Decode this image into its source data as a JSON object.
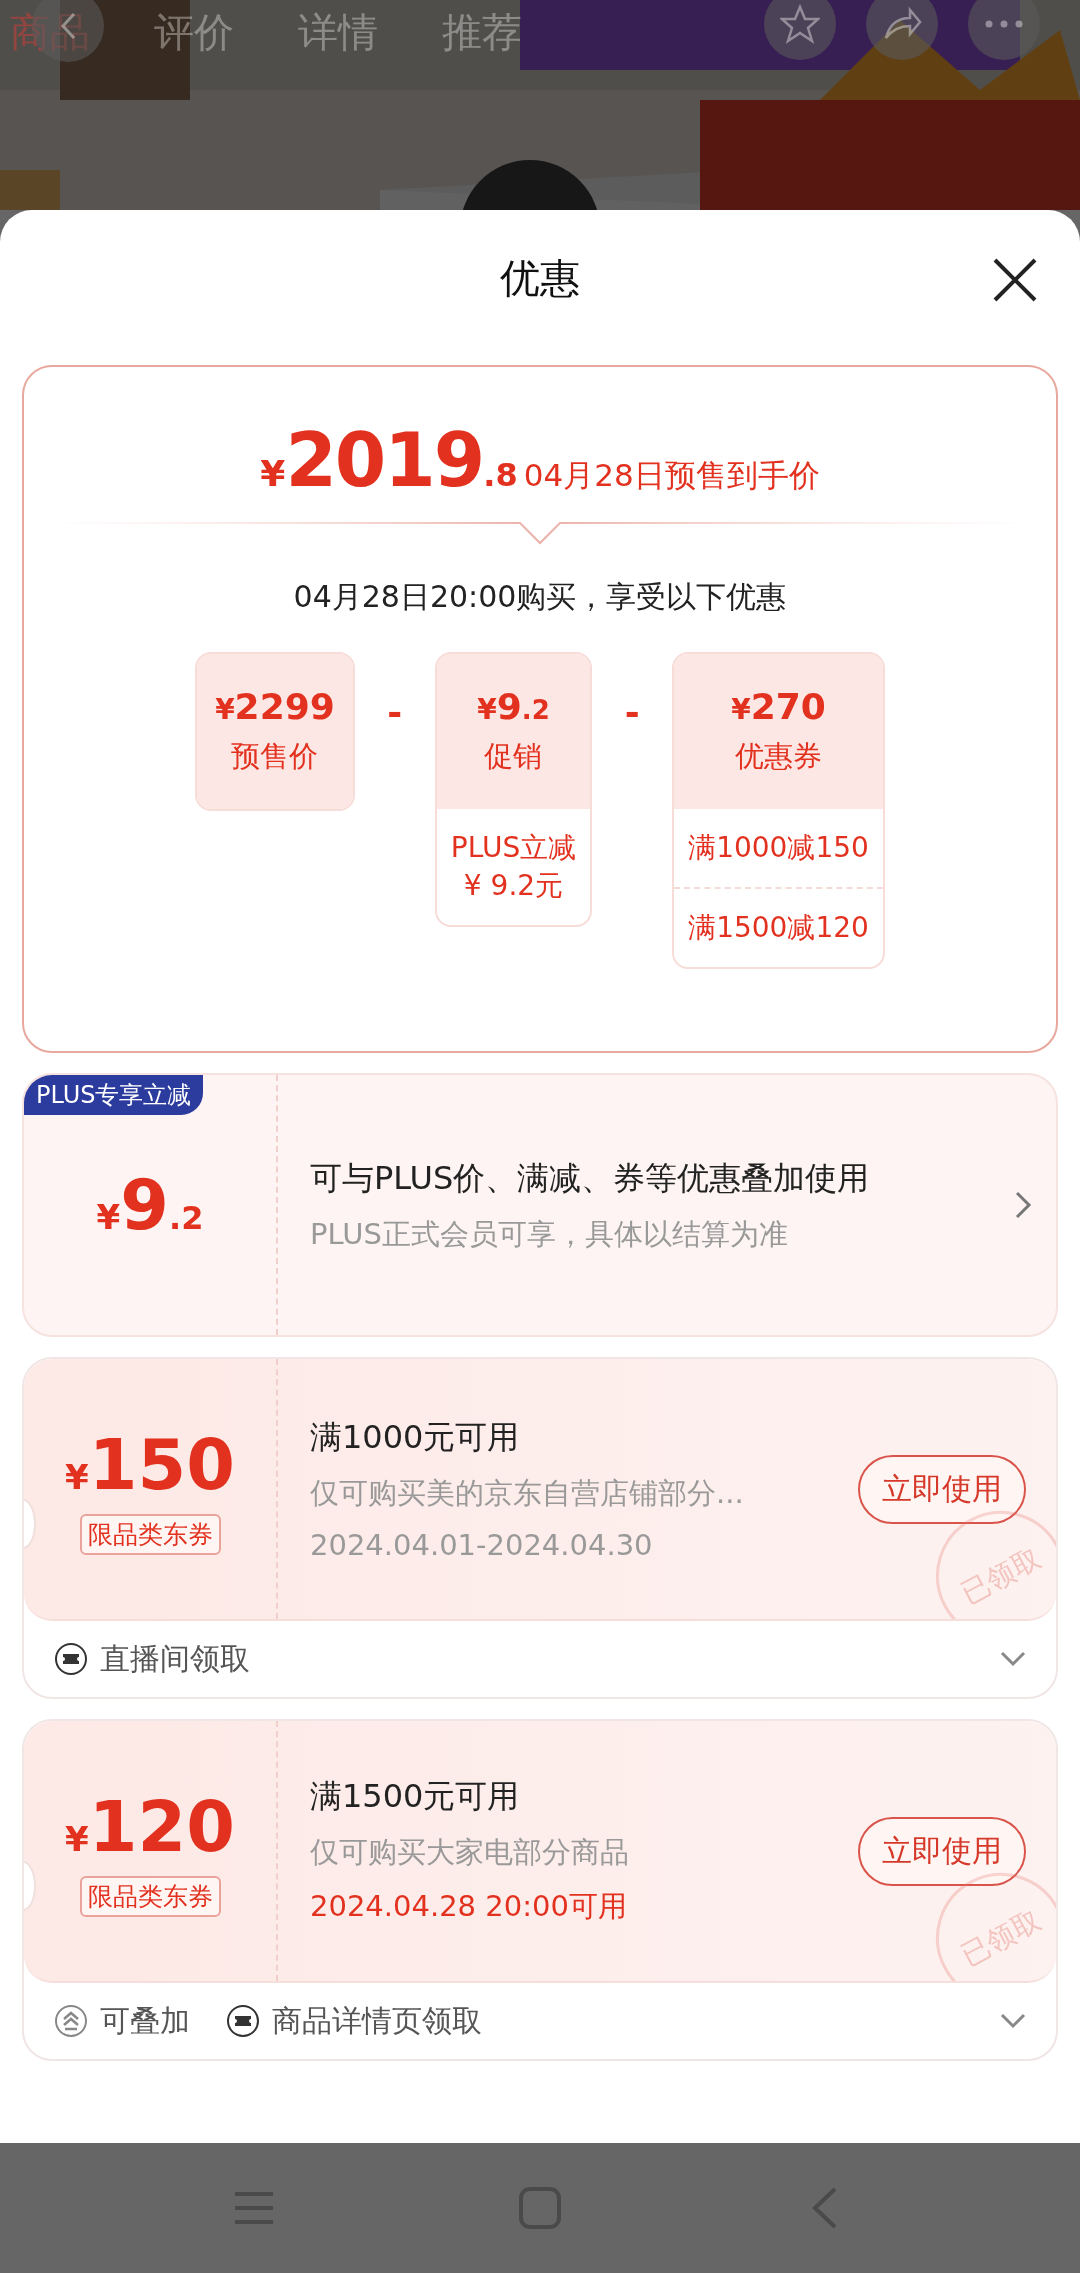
{
  "background_page": {
    "tabs": [
      {
        "label": "商品",
        "selected": true
      },
      {
        "label": "评价",
        "selected": false
      },
      {
        "label": "详情",
        "selected": false
      },
      {
        "label": "推荐",
        "selected": false
      }
    ]
  },
  "sheet": {
    "title": "优惠"
  },
  "summary": {
    "currency": "¥",
    "price_int": "2019",
    "price_dec": ".8",
    "price_label": "04月28日预售到手价",
    "purchase_note": "04月28日20:00购买，享受以下优惠",
    "items": [
      {
        "currency": "¥",
        "value": "2299",
        "label": "预售价"
      },
      {
        "operator": "-",
        "currency": "¥",
        "value": "9",
        "decimal": ".2",
        "label": "促销",
        "details": [
          [
            "PLUS立减",
            "¥ 9.2元"
          ]
        ]
      },
      {
        "operator": "-",
        "currency": "¥",
        "value": "270",
        "label": "优惠券",
        "details": [
          [
            "满1000减150"
          ],
          [
            "满1500减120"
          ]
        ]
      }
    ]
  },
  "offers": [
    {
      "kind": "plus",
      "badge": "PLUS专享立减",
      "currency": "¥",
      "value": "9",
      "decimal": ".2",
      "title": "可与PLUS价、满减、券等优惠叠加使用",
      "subtitle": "PLUS正式会员可享，具体以结算为准"
    },
    {
      "kind": "coupon",
      "currency": "¥",
      "value": "150",
      "tag": "限品类东券",
      "title": "满1000元可用",
      "description": "仅可购买美的京东自营店铺部分...",
      "validity": "2024.04.01-2024.04.30",
      "validity_highlight": false,
      "button": "立即使用",
      "stamp": "已领取",
      "footer": [
        {
          "kind": "source",
          "label": "直播间领取"
        }
      ]
    },
    {
      "kind": "coupon",
      "currency": "¥",
      "value": "120",
      "tag": "限品类东券",
      "title": "满1500元可用",
      "description": "仅可购买大家电部分商品",
      "validity": "2024.04.28 20:00可用",
      "validity_highlight": true,
      "button": "立即使用",
      "stamp": "已领取",
      "footer": [
        {
          "kind": "stackable",
          "label": "可叠加"
        },
        {
          "kind": "source",
          "label": "商品详情页领取"
        }
      ]
    }
  ]
}
